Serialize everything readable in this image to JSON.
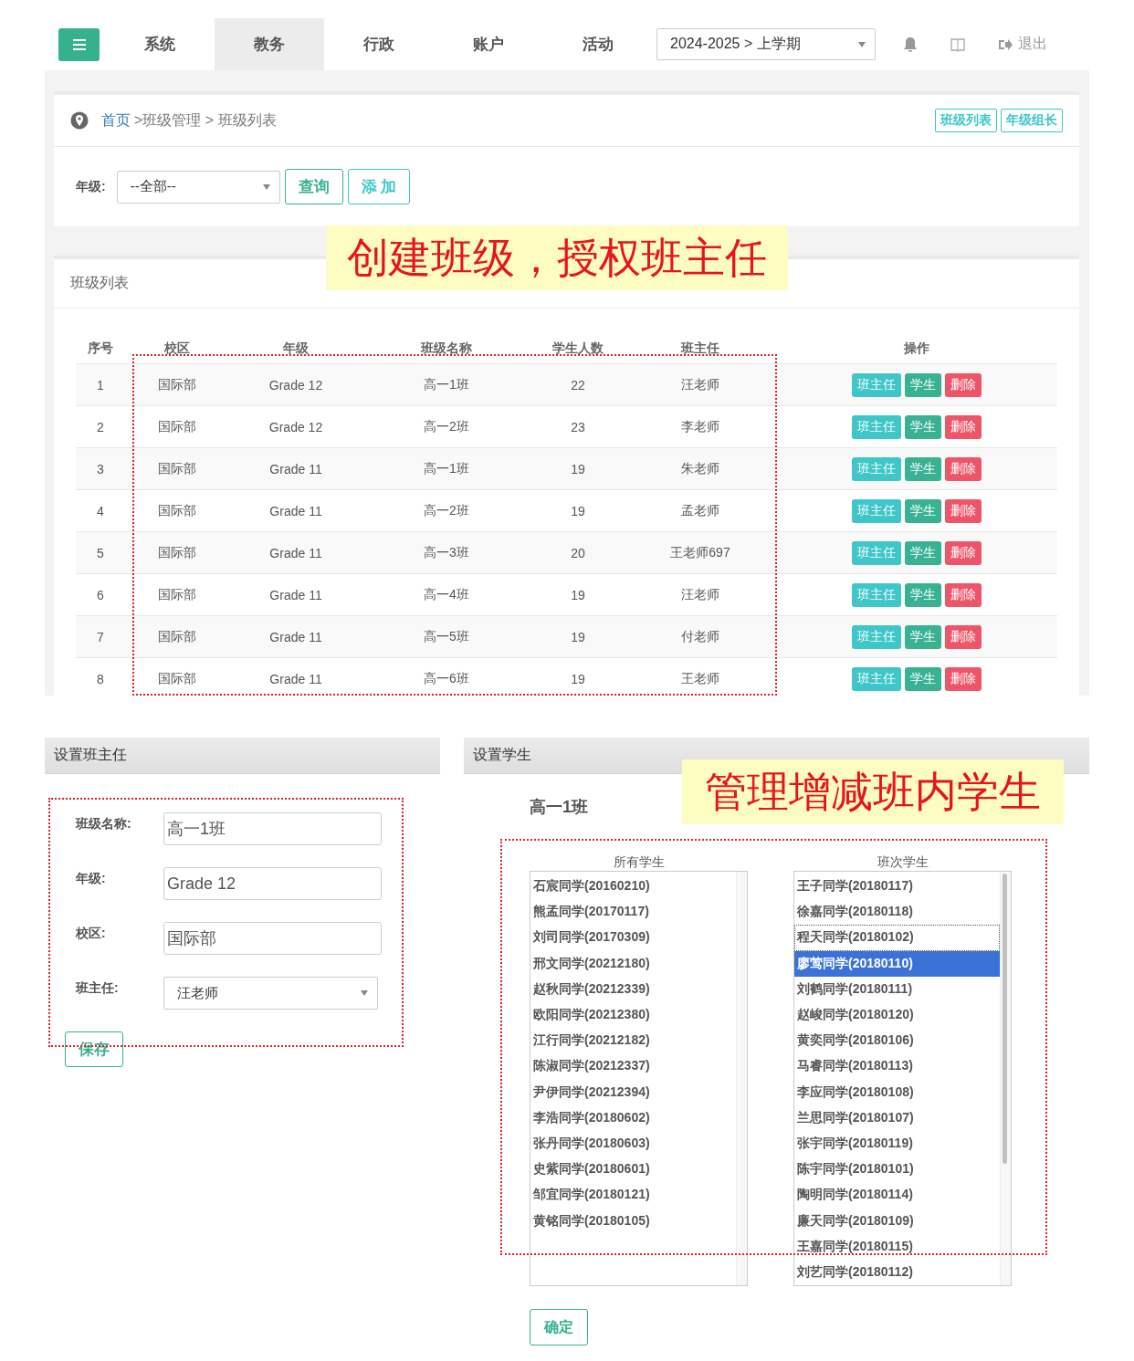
{
  "nav": {
    "items": [
      {
        "label": "系统",
        "selected": false
      },
      {
        "label": "教务",
        "selected": true
      },
      {
        "label": "行政",
        "selected": false
      },
      {
        "label": "账户",
        "selected": false
      },
      {
        "label": "活动",
        "selected": false
      }
    ],
    "term": "2024-2025 > 上学期",
    "logout": "退出"
  },
  "breadcrumb": {
    "home": "首页",
    "path": ">班级管理 > 班级列表"
  },
  "quick_links": [
    "班级列表",
    "年级组长"
  ],
  "filter": {
    "label": "年级:",
    "grade": "--全部--",
    "buttons": [
      "查询",
      "添 加"
    ]
  },
  "list_panel": {
    "title": "班级列表"
  },
  "table": {
    "columns": [
      "序号",
      "校区",
      "年级",
      "班级名称",
      "学生人数",
      "班主任",
      "操作"
    ],
    "rows": [
      {
        "cells": [
          "1",
          "国际部",
          "Grade 12",
          "高一1班",
          "22",
          "汪老师"
        ],
        "actions": [
          {
            "label": "班主任",
            "kind": "teacher"
          },
          {
            "label": "学生",
            "kind": "students"
          },
          {
            "label": "删除",
            "kind": "delete"
          }
        ]
      },
      {
        "cells": [
          "2",
          "国际部",
          "Grade 12",
          "高一2班",
          "23",
          "李老师"
        ],
        "actions": [
          {
            "label": "班主任",
            "kind": "teacher"
          },
          {
            "label": "学生",
            "kind": "students"
          },
          {
            "label": "删除",
            "kind": "delete"
          }
        ]
      },
      {
        "cells": [
          "3",
          "国际部",
          "Grade 11",
          "高一1班",
          "19",
          "朱老师"
        ],
        "actions": [
          {
            "label": "班主任",
            "kind": "teacher"
          },
          {
            "label": "学生",
            "kind": "students"
          },
          {
            "label": "删除",
            "kind": "delete"
          }
        ]
      },
      {
        "cells": [
          "4",
          "国际部",
          "Grade 11",
          "高一2班",
          "19",
          "孟老师"
        ],
        "actions": [
          {
            "label": "班主任",
            "kind": "teacher"
          },
          {
            "label": "学生",
            "kind": "students"
          },
          {
            "label": "删除",
            "kind": "delete"
          }
        ]
      },
      {
        "cells": [
          "5",
          "国际部",
          "Grade 11",
          "高一3班",
          "20",
          "王老师697"
        ],
        "actions": [
          {
            "label": "班主任",
            "kind": "teacher"
          },
          {
            "label": "学生",
            "kind": "students"
          },
          {
            "label": "删除",
            "kind": "delete"
          }
        ]
      },
      {
        "cells": [
          "6",
          "国际部",
          "Grade 11",
          "高一4班",
          "19",
          "汪老师"
        ],
        "actions": [
          {
            "label": "班主任",
            "kind": "teacher"
          },
          {
            "label": "学生",
            "kind": "students"
          },
          {
            "label": "删除",
            "kind": "delete"
          }
        ]
      },
      {
        "cells": [
          "7",
          "国际部",
          "Grade 11",
          "高一5班",
          "19",
          "付老师"
        ],
        "actions": [
          {
            "label": "班主任",
            "kind": "teacher"
          },
          {
            "label": "学生",
            "kind": "students"
          },
          {
            "label": "删除",
            "kind": "delete"
          }
        ]
      },
      {
        "cells": [
          "8",
          "国际部",
          "Grade 11",
          "高一6班",
          "19",
          "王老师"
        ],
        "actions": [
          {
            "label": "班主任",
            "kind": "teacher"
          },
          {
            "label": "学生",
            "kind": "students"
          },
          {
            "label": "删除",
            "kind": "delete"
          }
        ]
      }
    ]
  },
  "teacher_panel": {
    "title": "设置班主任",
    "fields": [
      {
        "label": "班级名称:",
        "value": "高一1班",
        "kind": "text"
      },
      {
        "label": "年级:",
        "value": "Grade 12",
        "kind": "text"
      },
      {
        "label": "校区:",
        "value": "国际部",
        "kind": "text"
      },
      {
        "label": "班主任:",
        "value": "汪老师",
        "kind": "select"
      }
    ],
    "save": "保存"
  },
  "student_panel": {
    "title": "设置学生",
    "class_name": "高一1班",
    "all_students": {
      "label": "所有学生",
      "items": [
        {
          "name": "石宸同学(20160210)",
          "selected": false
        },
        {
          "name": "熊孟同学(20170117)",
          "selected": false
        },
        {
          "name": "刘司同学(20170309)",
          "selected": false
        },
        {
          "name": "邢文同学(20212180)",
          "selected": false
        },
        {
          "name": "赵秋同学(20212339)",
          "selected": false
        },
        {
          "name": "欧阳同学(20212380)",
          "selected": false
        },
        {
          "name": "江行同学(20212182)",
          "selected": false
        },
        {
          "name": "陈淑同学(20212337)",
          "selected": false
        },
        {
          "name": "尹伊同学(20212394)",
          "selected": false
        },
        {
          "name": "李浩同学(20180602)",
          "selected": false
        },
        {
          "name": "张丹同学(20180603)",
          "selected": false
        },
        {
          "name": "史紫同学(20180601)",
          "selected": false
        },
        {
          "name": "邹宜同学(20180121)",
          "selected": false
        },
        {
          "name": "黄铭同学(20180105)",
          "selected": false
        }
      ]
    },
    "class_students": {
      "label": "班次学生",
      "items": [
        {
          "name": "王子同学(20180117)",
          "selected": false,
          "focused": false
        },
        {
          "name": "徐嘉同学(20180118)",
          "selected": false,
          "focused": false
        },
        {
          "name": "程天同学(20180102)",
          "selected": false,
          "focused": true
        },
        {
          "name": "廖莺同学(20180110)",
          "selected": true,
          "focused": false
        },
        {
          "name": "刘鹤同学(20180111)",
          "selected": false,
          "focused": false
        },
        {
          "name": "赵峻同学(20180120)",
          "selected": false,
          "focused": false
        },
        {
          "name": "黄奕同学(20180106)",
          "selected": false,
          "focused": false
        },
        {
          "name": "马睿同学(20180113)",
          "selected": false,
          "focused": false
        },
        {
          "name": "李应同学(20180108)",
          "selected": false,
          "focused": false
        },
        {
          "name": "兰思同学(20180107)",
          "selected": false,
          "focused": false
        },
        {
          "name": "张宇同学(20180119)",
          "selected": false,
          "focused": false
        },
        {
          "name": "陈宇同学(20180101)",
          "selected": false,
          "focused": false
        },
        {
          "name": "陶明同学(20180114)",
          "selected": false,
          "focused": false
        },
        {
          "name": "廉天同学(20180109)",
          "selected": false,
          "focused": false
        },
        {
          "name": "王嘉同学(20180115)",
          "selected": false,
          "focused": false
        },
        {
          "name": "刘艺同学(20180112)",
          "selected": false,
          "focused": false
        }
      ]
    },
    "confirm": "确定"
  },
  "annotations": [
    {
      "text": "创建班级，授权班主任"
    },
    {
      "text": "管理增减班内学生"
    }
  ]
}
